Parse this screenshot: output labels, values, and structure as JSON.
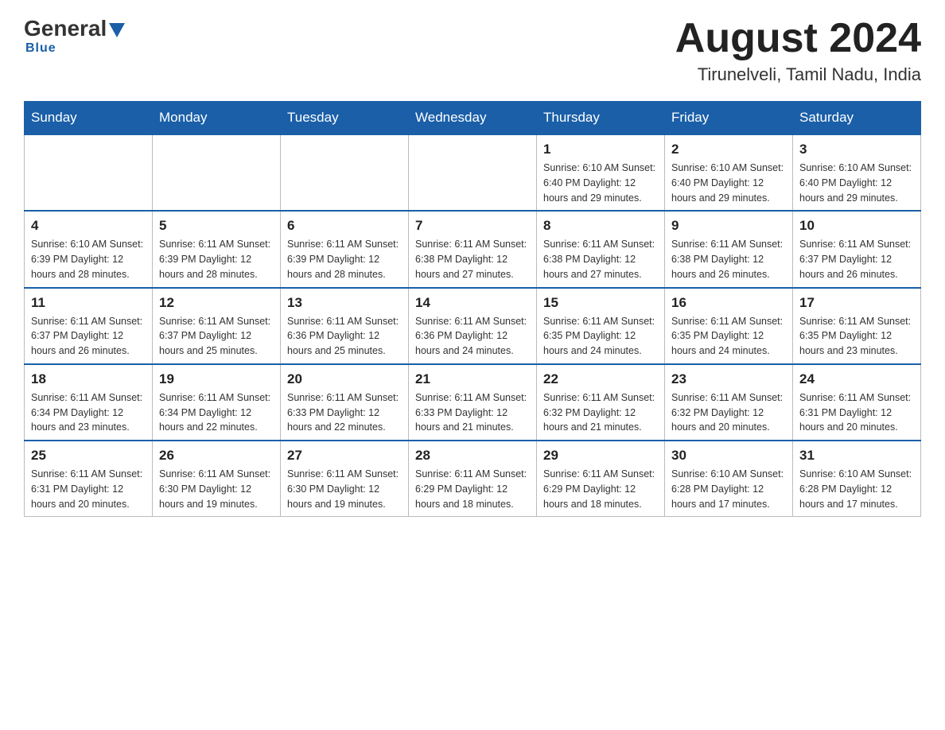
{
  "logo": {
    "general": "General",
    "blue": "Blue",
    "underline": "Blue"
  },
  "header": {
    "month": "August 2024",
    "location": "Tirunelveli, Tamil Nadu, India"
  },
  "weekdays": [
    "Sunday",
    "Monday",
    "Tuesday",
    "Wednesday",
    "Thursday",
    "Friday",
    "Saturday"
  ],
  "weeks": [
    [
      {
        "day": "",
        "info": ""
      },
      {
        "day": "",
        "info": ""
      },
      {
        "day": "",
        "info": ""
      },
      {
        "day": "",
        "info": ""
      },
      {
        "day": "1",
        "info": "Sunrise: 6:10 AM\nSunset: 6:40 PM\nDaylight: 12 hours and 29 minutes."
      },
      {
        "day": "2",
        "info": "Sunrise: 6:10 AM\nSunset: 6:40 PM\nDaylight: 12 hours and 29 minutes."
      },
      {
        "day": "3",
        "info": "Sunrise: 6:10 AM\nSunset: 6:40 PM\nDaylight: 12 hours and 29 minutes."
      }
    ],
    [
      {
        "day": "4",
        "info": "Sunrise: 6:10 AM\nSunset: 6:39 PM\nDaylight: 12 hours and 28 minutes."
      },
      {
        "day": "5",
        "info": "Sunrise: 6:11 AM\nSunset: 6:39 PM\nDaylight: 12 hours and 28 minutes."
      },
      {
        "day": "6",
        "info": "Sunrise: 6:11 AM\nSunset: 6:39 PM\nDaylight: 12 hours and 28 minutes."
      },
      {
        "day": "7",
        "info": "Sunrise: 6:11 AM\nSunset: 6:38 PM\nDaylight: 12 hours and 27 minutes."
      },
      {
        "day": "8",
        "info": "Sunrise: 6:11 AM\nSunset: 6:38 PM\nDaylight: 12 hours and 27 minutes."
      },
      {
        "day": "9",
        "info": "Sunrise: 6:11 AM\nSunset: 6:38 PM\nDaylight: 12 hours and 26 minutes."
      },
      {
        "day": "10",
        "info": "Sunrise: 6:11 AM\nSunset: 6:37 PM\nDaylight: 12 hours and 26 minutes."
      }
    ],
    [
      {
        "day": "11",
        "info": "Sunrise: 6:11 AM\nSunset: 6:37 PM\nDaylight: 12 hours and 26 minutes."
      },
      {
        "day": "12",
        "info": "Sunrise: 6:11 AM\nSunset: 6:37 PM\nDaylight: 12 hours and 25 minutes."
      },
      {
        "day": "13",
        "info": "Sunrise: 6:11 AM\nSunset: 6:36 PM\nDaylight: 12 hours and 25 minutes."
      },
      {
        "day": "14",
        "info": "Sunrise: 6:11 AM\nSunset: 6:36 PM\nDaylight: 12 hours and 24 minutes."
      },
      {
        "day": "15",
        "info": "Sunrise: 6:11 AM\nSunset: 6:35 PM\nDaylight: 12 hours and 24 minutes."
      },
      {
        "day": "16",
        "info": "Sunrise: 6:11 AM\nSunset: 6:35 PM\nDaylight: 12 hours and 24 minutes."
      },
      {
        "day": "17",
        "info": "Sunrise: 6:11 AM\nSunset: 6:35 PM\nDaylight: 12 hours and 23 minutes."
      }
    ],
    [
      {
        "day": "18",
        "info": "Sunrise: 6:11 AM\nSunset: 6:34 PM\nDaylight: 12 hours and 23 minutes."
      },
      {
        "day": "19",
        "info": "Sunrise: 6:11 AM\nSunset: 6:34 PM\nDaylight: 12 hours and 22 minutes."
      },
      {
        "day": "20",
        "info": "Sunrise: 6:11 AM\nSunset: 6:33 PM\nDaylight: 12 hours and 22 minutes."
      },
      {
        "day": "21",
        "info": "Sunrise: 6:11 AM\nSunset: 6:33 PM\nDaylight: 12 hours and 21 minutes."
      },
      {
        "day": "22",
        "info": "Sunrise: 6:11 AM\nSunset: 6:32 PM\nDaylight: 12 hours and 21 minutes."
      },
      {
        "day": "23",
        "info": "Sunrise: 6:11 AM\nSunset: 6:32 PM\nDaylight: 12 hours and 20 minutes."
      },
      {
        "day": "24",
        "info": "Sunrise: 6:11 AM\nSunset: 6:31 PM\nDaylight: 12 hours and 20 minutes."
      }
    ],
    [
      {
        "day": "25",
        "info": "Sunrise: 6:11 AM\nSunset: 6:31 PM\nDaylight: 12 hours and 20 minutes."
      },
      {
        "day": "26",
        "info": "Sunrise: 6:11 AM\nSunset: 6:30 PM\nDaylight: 12 hours and 19 minutes."
      },
      {
        "day": "27",
        "info": "Sunrise: 6:11 AM\nSunset: 6:30 PM\nDaylight: 12 hours and 19 minutes."
      },
      {
        "day": "28",
        "info": "Sunrise: 6:11 AM\nSunset: 6:29 PM\nDaylight: 12 hours and 18 minutes."
      },
      {
        "day": "29",
        "info": "Sunrise: 6:11 AM\nSunset: 6:29 PM\nDaylight: 12 hours and 18 minutes."
      },
      {
        "day": "30",
        "info": "Sunrise: 6:10 AM\nSunset: 6:28 PM\nDaylight: 12 hours and 17 minutes."
      },
      {
        "day": "31",
        "info": "Sunrise: 6:10 AM\nSunset: 6:28 PM\nDaylight: 12 hours and 17 minutes."
      }
    ]
  ]
}
